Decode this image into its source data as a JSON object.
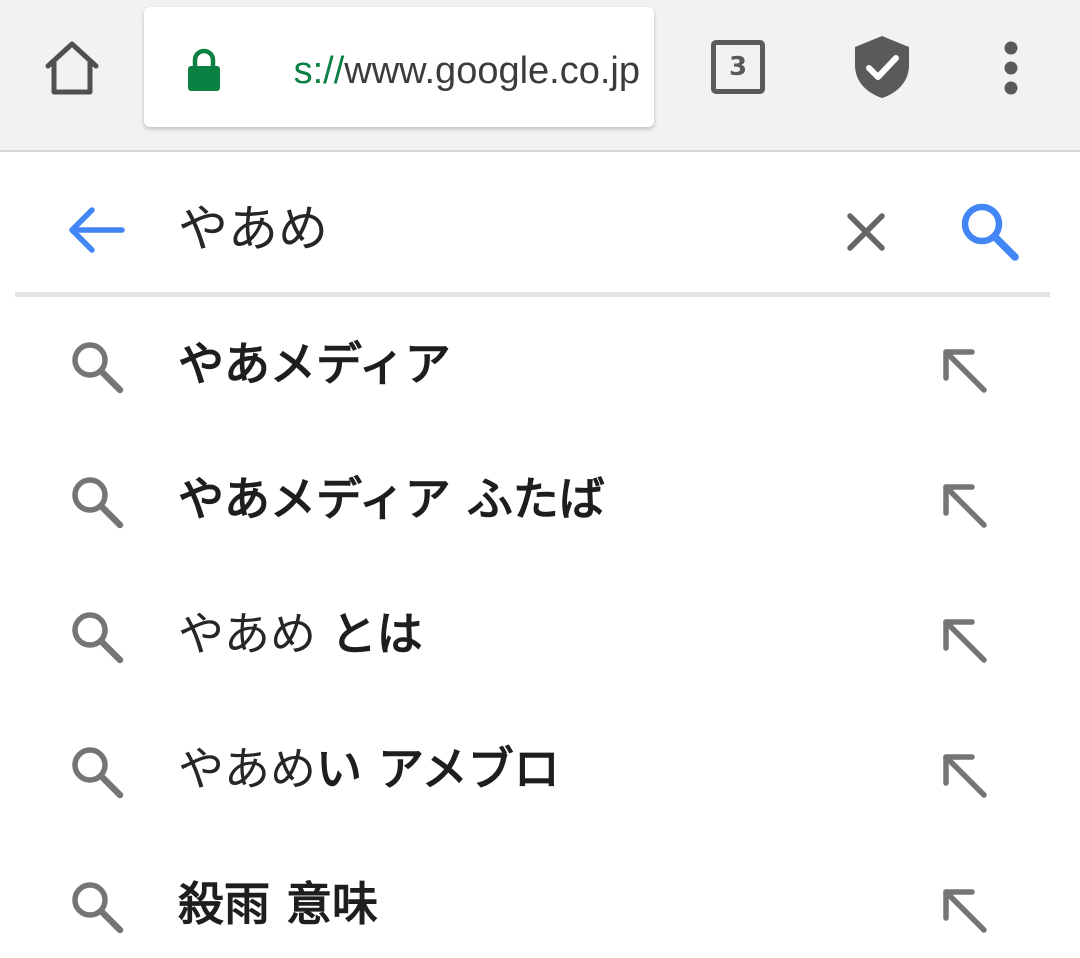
{
  "toolbar": {
    "url_scheme_partial": "s://",
    "url_host": "www.google.co.jp",
    "tab_count": "3",
    "icons": [
      "home-icon",
      "lock-icon",
      "tab-switcher-icon",
      "shield-check-icon",
      "more-vert-icon"
    ],
    "lock_color": "#0b8043"
  },
  "search": {
    "query": "やあめ",
    "icons": [
      "arrow-back-icon",
      "close-icon",
      "search-icon"
    ],
    "accent_color": "#4285f4"
  },
  "suggestions": [
    {
      "normal": "",
      "bold": "やあメディア"
    },
    {
      "normal": "",
      "bold": "やあメディア ふたば"
    },
    {
      "normal": "やあめ ",
      "bold": "とは"
    },
    {
      "normal": "やあめ",
      "bold": "い アメブロ"
    },
    {
      "normal": "",
      "bold": "殺雨 意味"
    }
  ]
}
